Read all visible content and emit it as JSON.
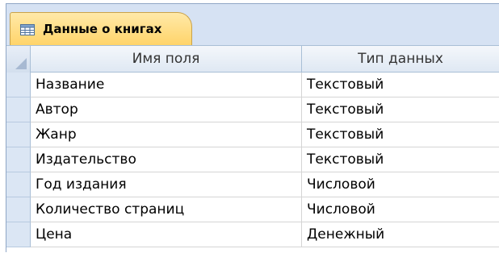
{
  "tab": {
    "label": "Данные о книгах",
    "icon": "table-icon"
  },
  "columns": [
    "Имя поля",
    "Тип данных"
  ],
  "rows": [
    {
      "field": "Название",
      "type": "Текстовый"
    },
    {
      "field": "Автор",
      "type": "Текстовый"
    },
    {
      "field": "Жанр",
      "type": "Текстовый"
    },
    {
      "field": "Издательство",
      "type": "Текстовый"
    },
    {
      "field": "Год издания",
      "type": "Числовой"
    },
    {
      "field": "Количество страниц",
      "type": "Числовой"
    },
    {
      "field": "Цена",
      "type": "Денежный"
    }
  ],
  "colors": {
    "tab_background": "#ffd46a",
    "frame_background": "#cfdcef",
    "row_selector": "#dbe6f4"
  }
}
